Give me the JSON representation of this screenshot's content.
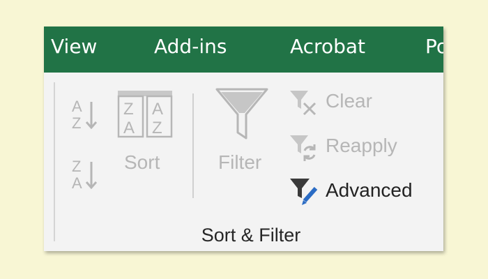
{
  "tabs": [
    {
      "label": "View"
    },
    {
      "label": "Add-ins"
    },
    {
      "label": "Acrobat"
    },
    {
      "label": "Po"
    }
  ],
  "group": {
    "label": "Sort & Filter",
    "sort_az": {
      "icon": "sort-a-to-z-icon",
      "top_letter": "A",
      "bottom_letter": "Z",
      "state": "disabled"
    },
    "sort_za": {
      "icon": "sort-z-to-a-icon",
      "top_letter": "Z",
      "bottom_letter": "A",
      "state": "disabled"
    },
    "sort": {
      "label": "Sort",
      "icon": "sort-dialog-icon",
      "grid_letters": [
        "Z",
        "A",
        "A",
        "Z"
      ],
      "state": "disabled"
    },
    "filter": {
      "label": "Filter",
      "icon": "funnel-icon",
      "state": "disabled"
    },
    "clear": {
      "label": "Clear",
      "icon": "clear-filter-icon",
      "state": "disabled"
    },
    "reapply": {
      "label": "Reapply",
      "icon": "reapply-filter-icon",
      "state": "disabled"
    },
    "advanced": {
      "label": "Advanced",
      "icon": "advanced-filter-icon",
      "state": "enabled"
    }
  },
  "colors": {
    "tab_bar": "#217346",
    "ribbon_bg": "#f3f3f3",
    "page_bg": "#f8f6d4",
    "disabled": "#b6b6b6",
    "enabled_text": "#222222",
    "accent_blue": "#2b6cc4"
  }
}
